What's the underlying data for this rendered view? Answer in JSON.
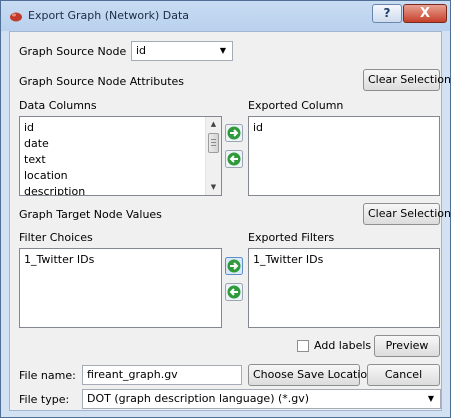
{
  "window": {
    "title": "Export Graph (Network) Data",
    "help_label": "?",
    "close_label": "X"
  },
  "source_node": {
    "label": "Graph Source Node",
    "selected": "id"
  },
  "source_attributes": {
    "label": "Graph Source Node Attributes",
    "clear_label": "Clear Selection"
  },
  "data_columns": {
    "label": "Data Columns",
    "items": [
      "id",
      "date",
      "text",
      "location",
      "description"
    ]
  },
  "exported_column": {
    "label": "Exported Column",
    "items": [
      "id"
    ]
  },
  "target_values": {
    "label": "Graph Target Node Values",
    "clear_label": "Clear Selection"
  },
  "filter_choices": {
    "label": "Filter Choices",
    "items": [
      "1_Twitter IDs"
    ]
  },
  "exported_filters": {
    "label": "Exported Filters",
    "items": [
      "1_Twitter IDs"
    ]
  },
  "options": {
    "add_labels": "Add labels",
    "preview": "Preview"
  },
  "file": {
    "name_label": "File name:",
    "name_value": "fireant_graph.gv",
    "choose_label": "Choose Save Location",
    "cancel_label": "Cancel",
    "type_label": "File type:",
    "type_value": "DOT (graph description language) (*.gv)"
  },
  "colors": {
    "arrow_green": "#2f9a3c",
    "close_red": "#c6402b",
    "window_frame": "#d3e2f3"
  }
}
